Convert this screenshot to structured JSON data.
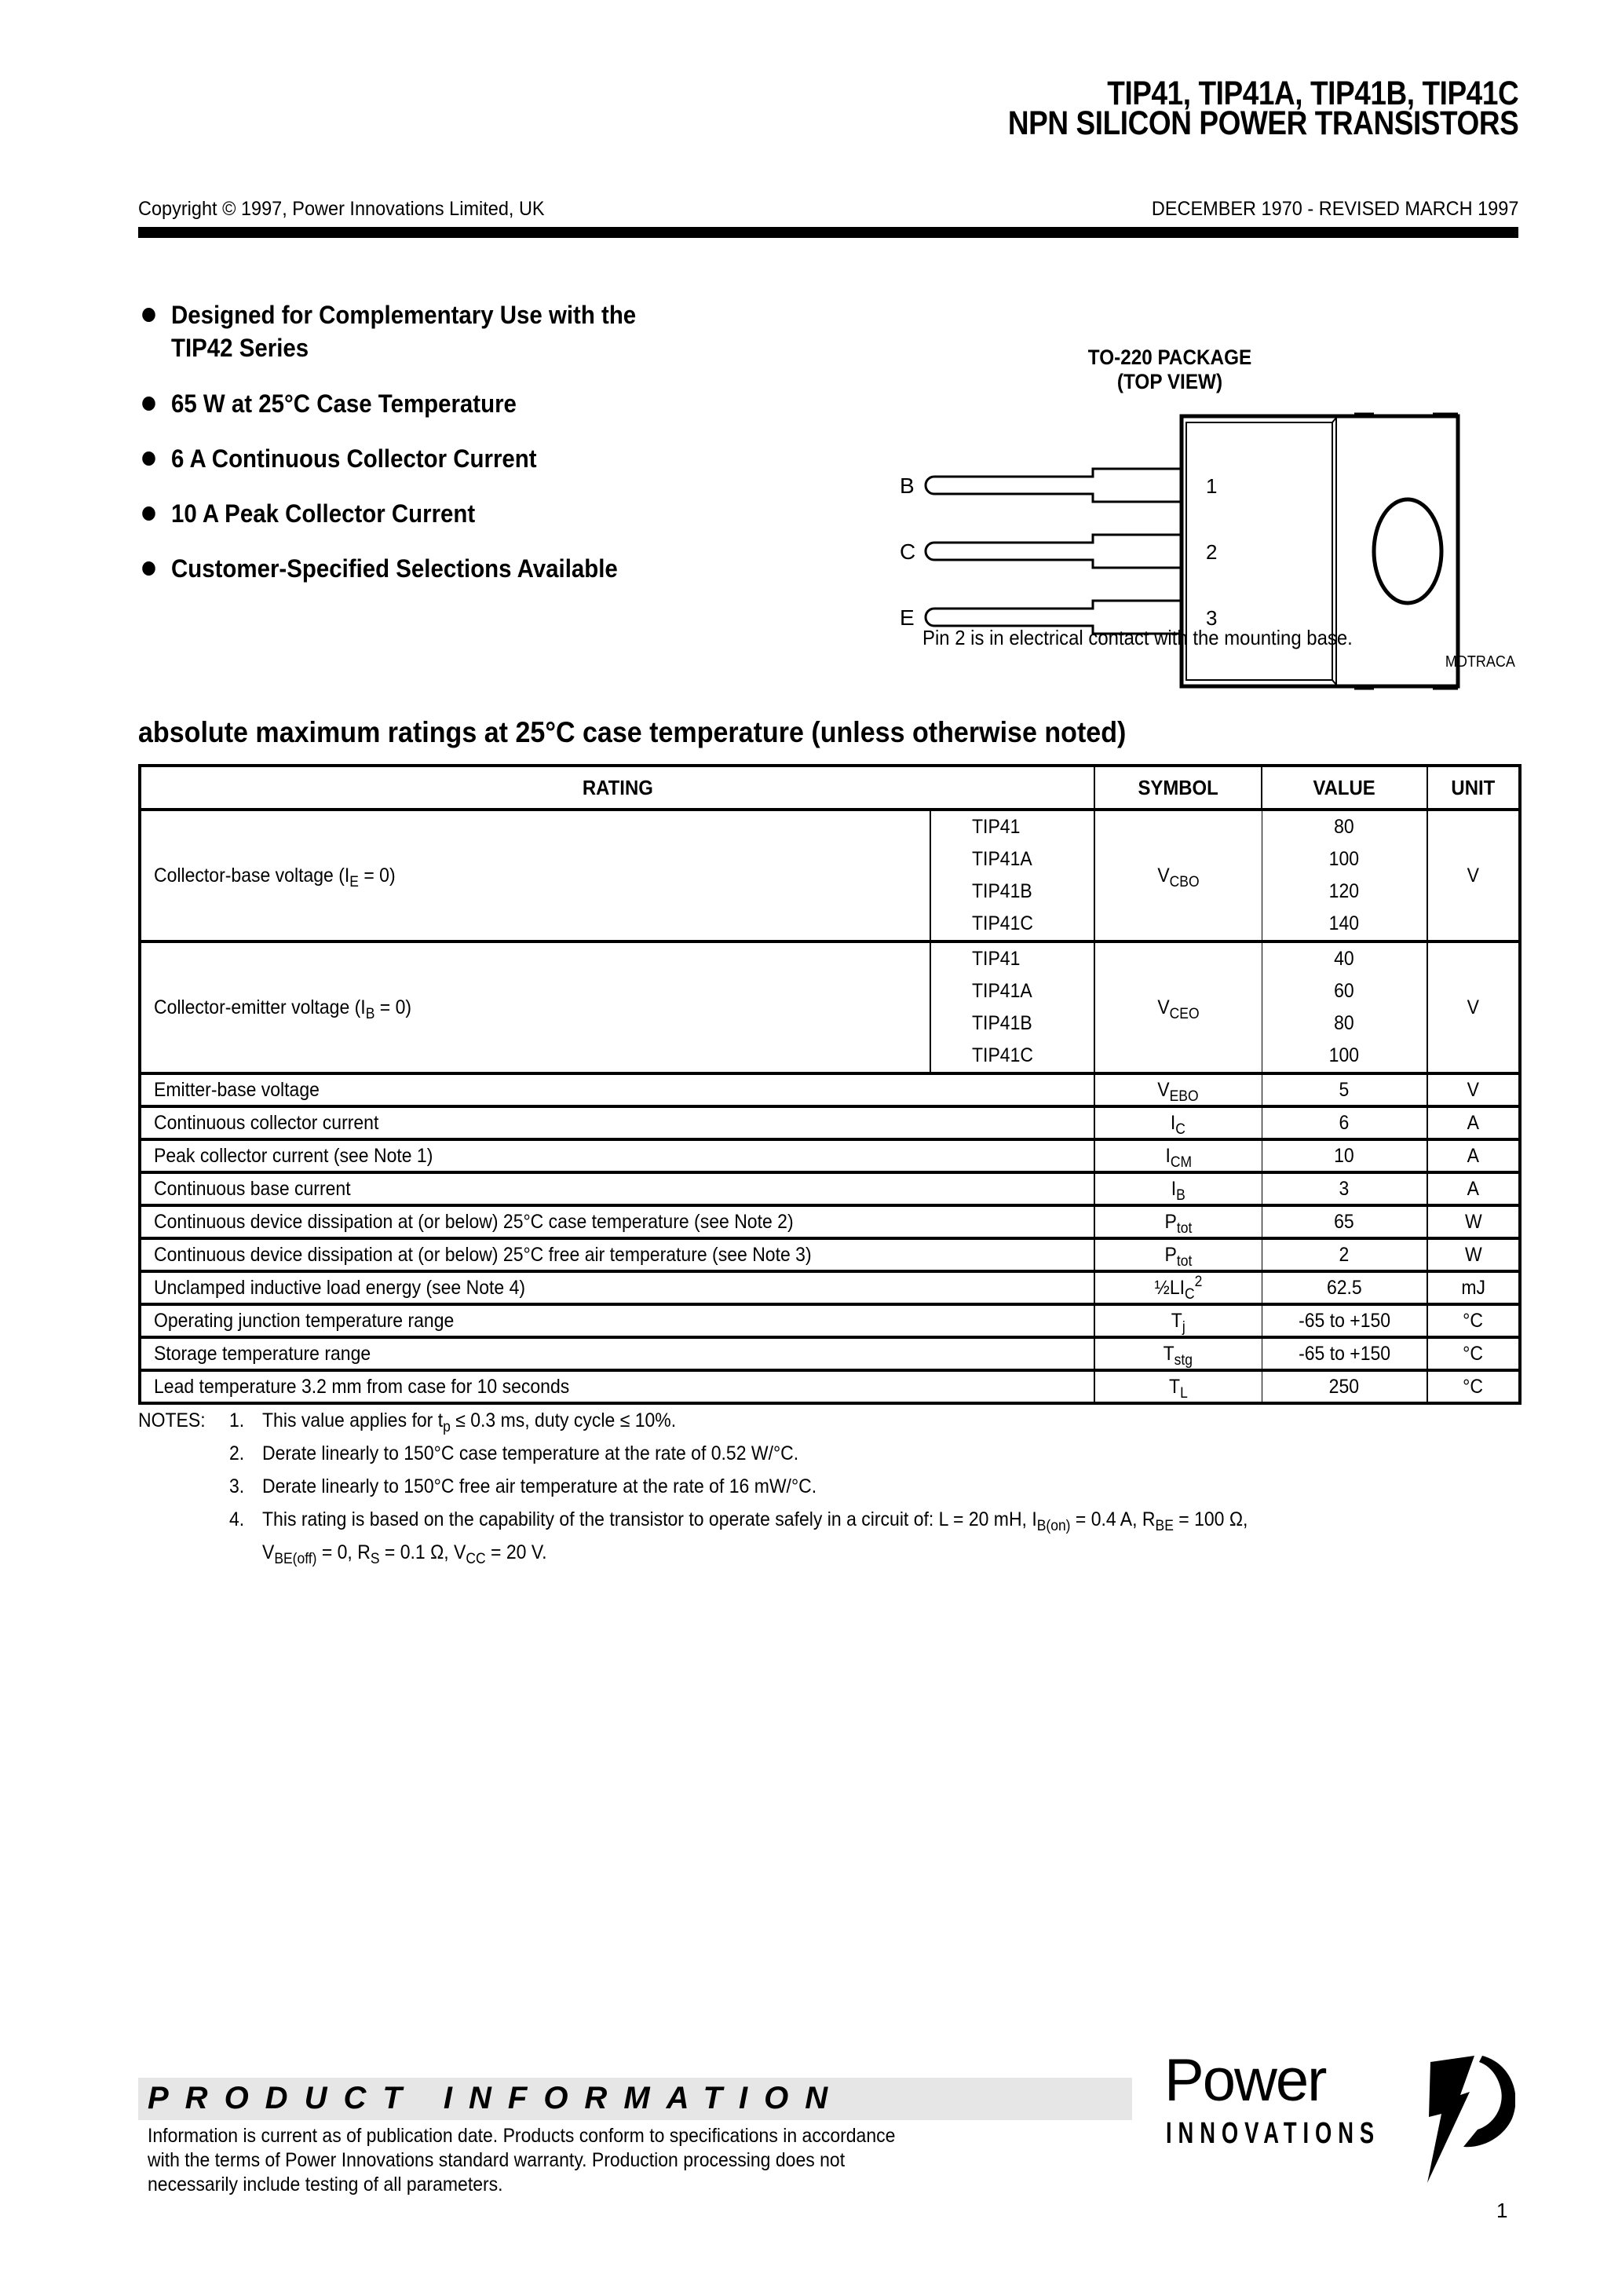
{
  "header": {
    "title_line1": "TIP41, TIP41A, TIP41B, TIP41C",
    "title_line2": "NPN SILICON POWER TRANSISTORS",
    "copyright": "Copyright © 1997, Power Innovations Limited, UK",
    "revision": "DECEMBER 1970 - REVISED MARCH 1997"
  },
  "features": [
    {
      "line1": "Designed for Complementary Use with the",
      "line2": "TIP42 Series"
    },
    {
      "line1": "65 W at 25°C Case Temperature"
    },
    {
      "line1": "6 A Continuous Collector Current"
    },
    {
      "line1": "10 A Peak Collector Current"
    },
    {
      "line1": "Customer-Specified Selections Available"
    }
  ],
  "package": {
    "title_line1": "TO-220 PACKAGE",
    "title_line2": "(TOP VIEW)",
    "pins": [
      {
        "letter": "B",
        "number": "1"
      },
      {
        "letter": "C",
        "number": "2"
      },
      {
        "letter": "E",
        "number": "3"
      }
    ],
    "note": "Pin 2 is in electrical contact with the mounting base.",
    "drawing_code": "MDTRACA"
  },
  "ratings": {
    "heading": "absolute maximum ratings at 25°C case temperature (unless otherwise noted)",
    "columns": {
      "rating": "RATING",
      "symbol": "SYMBOL",
      "value": "VALUE",
      "unit": "UNIT"
    },
    "groups": [
      {
        "rating": "Collector-base voltage (I",
        "rating_sub": "E",
        "rating_tail": " = 0)",
        "symbol": "V",
        "symbol_sub": "CBO",
        "unit": "V",
        "variants": [
          {
            "device": "TIP41",
            "value": "80"
          },
          {
            "device": "TIP41A",
            "value": "100"
          },
          {
            "device": "TIP41B",
            "value": "120"
          },
          {
            "device": "TIP41C",
            "value": "140"
          }
        ]
      },
      {
        "rating": "Collector-emitter voltage (I",
        "rating_sub": "B",
        "rating_tail": " = 0)",
        "symbol": "V",
        "symbol_sub": "CEO",
        "unit": "V",
        "variants": [
          {
            "device": "TIP41",
            "value": "40"
          },
          {
            "device": "TIP41A",
            "value": "60"
          },
          {
            "device": "TIP41B",
            "value": "80"
          },
          {
            "device": "TIP41C",
            "value": "100"
          }
        ]
      }
    ],
    "rows": [
      {
        "rating": "Emitter-base voltage",
        "symbol": "V",
        "symbol_sub": "EBO",
        "symbol_sup": "",
        "value": "5",
        "unit": "V"
      },
      {
        "rating": "Continuous collector current",
        "symbol": "I",
        "symbol_sub": "C",
        "symbol_sup": "",
        "value": "6",
        "unit": "A"
      },
      {
        "rating": "Peak collector current (see Note 1)",
        "symbol": "I",
        "symbol_sub": "CM",
        "symbol_sup": "",
        "value": "10",
        "unit": "A"
      },
      {
        "rating": "Continuous base current",
        "symbol": "I",
        "symbol_sub": "B",
        "symbol_sup": "",
        "value": "3",
        "unit": "A"
      },
      {
        "rating": "Continuous device dissipation at (or below) 25°C case temperature (see Note 2)",
        "symbol": "P",
        "symbol_sub": "tot",
        "symbol_sup": "",
        "value": "65",
        "unit": "W"
      },
      {
        "rating": "Continuous device dissipation at (or below) 25°C free air temperature (see Note 3)",
        "symbol": "P",
        "symbol_sub": "tot",
        "symbol_sup": "",
        "value": "2",
        "unit": "W"
      },
      {
        "rating": "Unclamped inductive load energy (see Note 4)",
        "symbol": "½LI",
        "symbol_sub": "C",
        "symbol_sup": "2",
        "value": "62.5",
        "unit": "mJ"
      },
      {
        "rating": "Operating junction temperature range",
        "symbol": "T",
        "symbol_sub": "j",
        "symbol_sup": "",
        "value": "-65 to +150",
        "unit": "°C"
      },
      {
        "rating": "Storage temperature range",
        "symbol": "T",
        "symbol_sub": "stg",
        "symbol_sup": "",
        "value": "-65 to +150",
        "unit": "°C"
      },
      {
        "rating": "Lead temperature 3.2 mm from case for 10 seconds",
        "symbol": "T",
        "symbol_sub": "L",
        "symbol_sup": "",
        "value": "250",
        "unit": "°C"
      }
    ]
  },
  "notes": {
    "label": "NOTES:",
    "items": [
      {
        "num": "1.",
        "parts": [
          "This value applies for t",
          {
            "sub": "p"
          },
          " ≤ 0.3 ms, duty cycle ≤ 10%."
        ]
      },
      {
        "num": "2.",
        "parts": [
          "Derate linearly to 150°C  case temperature at the rate of 0.52 W/°C."
        ]
      },
      {
        "num": "3.",
        "parts": [
          "Derate linearly to 150°C  free air temperature at the rate of 16 mW/°C."
        ]
      },
      {
        "num": "4.",
        "parts": [
          "This rating is based on the capability of the transistor to operate safely in a circuit of: L = 20 mH, I",
          {
            "sub": "B(on)"
          },
          " = 0.4 A, R",
          {
            "sub": "BE"
          },
          " = 100 Ω,"
        ],
        "continuation": [
          "V",
          {
            "sub": "BE(off)"
          },
          " = 0, R",
          {
            "sub": "S"
          },
          " = 0.1 Ω, V",
          {
            "sub": "CC"
          },
          " = 20 V."
        ]
      }
    ]
  },
  "footer": {
    "section_title": "PRODUCT   INFORMATION",
    "disclaimer_lines": [
      "Information is current as of publication date. Products conform to specifications in accordance",
      "with the terms of Power Innovations standard warranty. Production processing does not",
      "necessarily include testing of all parameters."
    ],
    "logo_word1": "Power",
    "logo_word2": "INNOVATIONS",
    "page_number": "1"
  }
}
